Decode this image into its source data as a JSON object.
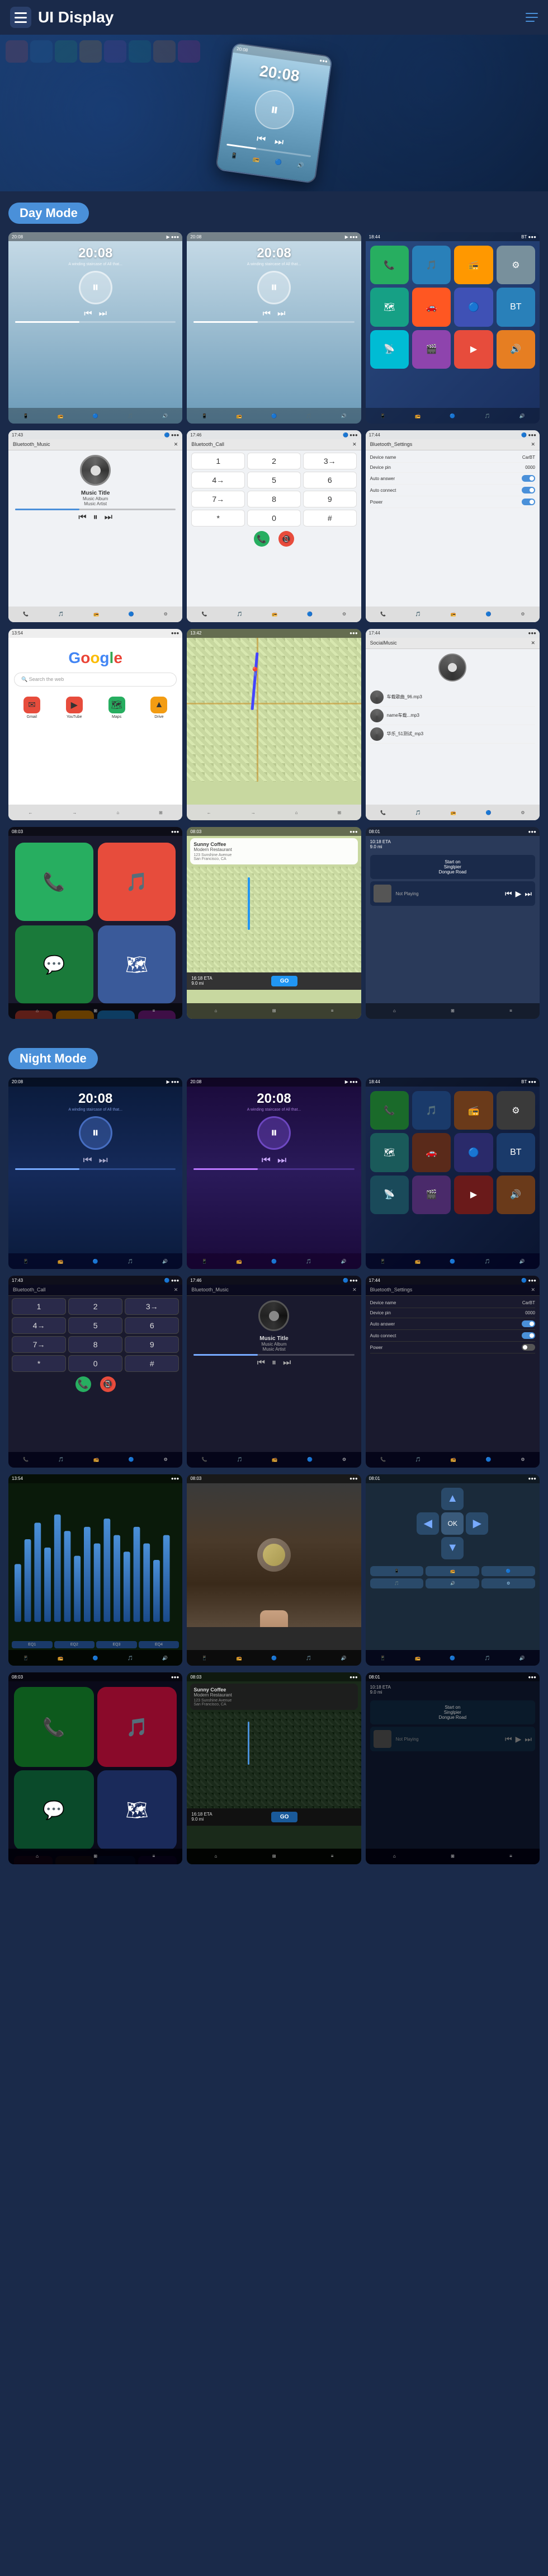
{
  "header": {
    "title": "UI Display",
    "menu_icon": "☰",
    "nav_icon": "≡"
  },
  "hero": {
    "device_time": "20:08"
  },
  "day_mode": {
    "label": "Day Mode",
    "screens": [
      {
        "id": "day-music-1",
        "type": "music",
        "time": "20:08",
        "subtitle": "A winding staircase of All that...",
        "bg": "day"
      },
      {
        "id": "day-music-2",
        "type": "music",
        "time": "20:08",
        "subtitle": "A winding staircase of All that...",
        "bg": "day"
      },
      {
        "id": "day-apps",
        "type": "apps",
        "bg": "dark-blue"
      },
      {
        "id": "bt-music",
        "type": "bluetooth-music",
        "header": "Bluetooth_Music",
        "track": "Music Title",
        "album": "Music Album",
        "artist": "Music Artist"
      },
      {
        "id": "bt-call",
        "type": "bluetooth-call",
        "header": "Bluetooth_Call"
      },
      {
        "id": "bt-settings",
        "type": "bluetooth-settings",
        "header": "Bluetooth_Settings",
        "device_name_label": "Device name",
        "device_name_val": "CarBT",
        "device_pin_label": "Device pin",
        "device_pin_val": "0000",
        "auto_answer_label": "Auto answer",
        "auto_connect_label": "Auto connect",
        "power_label": "Power"
      },
      {
        "id": "google",
        "type": "google",
        "search_placeholder": "Search the web"
      },
      {
        "id": "maps-day",
        "type": "maps",
        "bg": "map"
      },
      {
        "id": "social-music",
        "type": "social-music",
        "header": "SocialMusic",
        "songs": [
          "车载歌曲_96.mp3",
          "name车载...mp3",
          "华乐_51测试_mp3"
        ]
      },
      {
        "id": "carplay-home",
        "type": "carplay",
        "bg": "dark"
      },
      {
        "id": "carplay-nav",
        "type": "carplay-navigation",
        "restaurant": "Sunny Coffee\nModern Restaurant",
        "address": "123 Sunshine Avenue\nSan Francisco, CA",
        "eta": "10:18 ETA",
        "distance": "9.0 mi",
        "time_away": "16:18 ETA"
      },
      {
        "id": "carplay-music",
        "type": "carplay-music",
        "eta": "08:01",
        "distance": "9.0 mi",
        "road": "Start on\nSinglpier\nDongue Road",
        "status": "Not Playing"
      }
    ]
  },
  "night_mode": {
    "label": "Night Mode",
    "screens": [
      {
        "id": "night-music-1",
        "type": "music-night",
        "time": "20:08",
        "subtitle": "A winding staircase of All that...",
        "bg": "night-blue"
      },
      {
        "id": "night-music-2",
        "type": "music-night",
        "time": "20:08",
        "subtitle": "A winding staircase of All that...",
        "bg": "night-purple"
      },
      {
        "id": "night-apps",
        "type": "apps-night",
        "bg": "dark"
      },
      {
        "id": "night-bt-call",
        "type": "bluetooth-call-night",
        "header": "Bluetooth_Call"
      },
      {
        "id": "night-bt-music",
        "type": "bluetooth-music-night",
        "header": "Bluetooth_Music",
        "track": "Music Title",
        "album": "Music Album",
        "artist": "Music Artist"
      },
      {
        "id": "night-bt-settings",
        "type": "bluetooth-settings-night",
        "header": "Bluetooth_Settings",
        "device_name_label": "Device name",
        "device_name_val": "CarBT",
        "device_pin_label": "Device pin",
        "device_pin_val": "0000",
        "auto_answer_label": "Auto answer",
        "auto_connect_label": "Auto connect",
        "power_label": "Power"
      },
      {
        "id": "night-eq",
        "type": "equalizer-night"
      },
      {
        "id": "night-food",
        "type": "food-image"
      },
      {
        "id": "night-grid",
        "type": "night-grid"
      },
      {
        "id": "night-carplay-home",
        "type": "carplay-night"
      },
      {
        "id": "night-carplay-nav",
        "type": "carplay-nav-night",
        "restaurant": "Sunny Coffee\nModern Restaurant",
        "address": "123 Sunshine Avenue",
        "eta": "10:18 ETA",
        "distance": "9.0 mi"
      },
      {
        "id": "night-carplay-music",
        "type": "carplay-music-night",
        "road": "Start on\nSinglpier\nDongue Road",
        "status": "Not Playing"
      }
    ]
  },
  "music_album_artist": {
    "album": "Music Album",
    "artist": "Music Artist",
    "title": "Music Title"
  }
}
